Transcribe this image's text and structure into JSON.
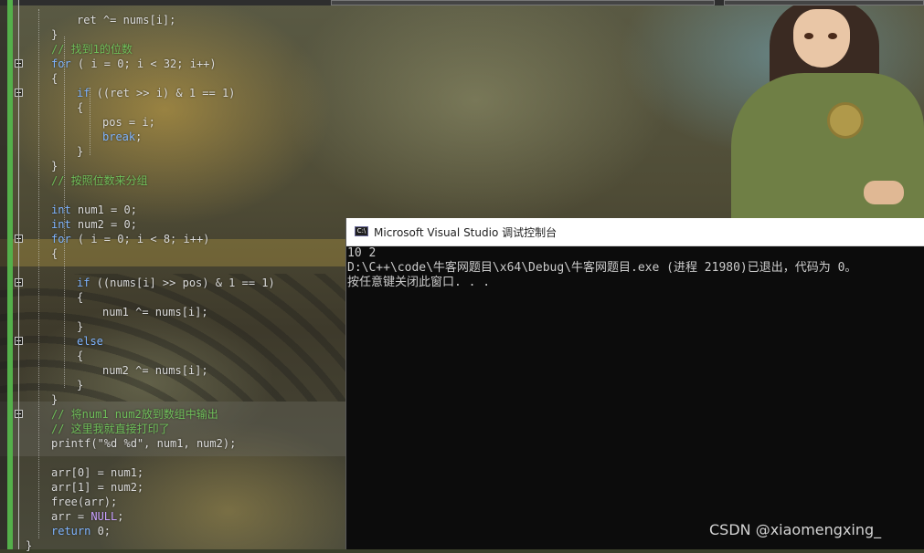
{
  "editor": {
    "code_lines": [
      {
        "indent": 2,
        "text": "ret ^= nums[i];",
        "kind": "code"
      },
      {
        "indent": 1,
        "text": "}",
        "kind": "code"
      },
      {
        "indent": 1,
        "text": "// 找到1的位数",
        "kind": "comment"
      },
      {
        "indent": 1,
        "text": "for ( i = 0; i < 32; i++)",
        "kind": "code"
      },
      {
        "indent": 1,
        "text": "{",
        "kind": "code"
      },
      {
        "indent": 2,
        "text": "if ((ret >> i) & 1 == 1)",
        "kind": "code"
      },
      {
        "indent": 2,
        "text": "{",
        "kind": "code"
      },
      {
        "indent": 3,
        "text": "pos = i;",
        "kind": "code"
      },
      {
        "indent": 3,
        "text": "break;",
        "kind": "code"
      },
      {
        "indent": 2,
        "text": "}",
        "kind": "code"
      },
      {
        "indent": 1,
        "text": "}",
        "kind": "code"
      },
      {
        "indent": 1,
        "text": "// 按照位数来分组",
        "kind": "comment"
      },
      {
        "indent": 0,
        "text": "",
        "kind": "code"
      },
      {
        "indent": 1,
        "text": "int num1 = 0;",
        "kind": "code"
      },
      {
        "indent": 1,
        "text": "int num2 = 0;",
        "kind": "code"
      },
      {
        "indent": 1,
        "text": "for ( i = 0; i < 8; i++)",
        "kind": "code"
      },
      {
        "indent": 1,
        "text": "{",
        "kind": "code"
      },
      {
        "indent": 0,
        "text": "",
        "kind": "code"
      },
      {
        "indent": 2,
        "text": "if ((nums[i] >> pos) & 1 == 1)",
        "kind": "code"
      },
      {
        "indent": 2,
        "text": "{",
        "kind": "code"
      },
      {
        "indent": 3,
        "text": "num1 ^= nums[i];",
        "kind": "code"
      },
      {
        "indent": 2,
        "text": "}",
        "kind": "code"
      },
      {
        "indent": 2,
        "text": "else",
        "kind": "code"
      },
      {
        "indent": 2,
        "text": "{",
        "kind": "code"
      },
      {
        "indent": 3,
        "text": "num2 ^= nums[i];",
        "kind": "code"
      },
      {
        "indent": 2,
        "text": "}",
        "kind": "code"
      },
      {
        "indent": 1,
        "text": "}",
        "kind": "code"
      },
      {
        "indent": 1,
        "text": "// 将num1 num2放到数组中输出",
        "kind": "comment"
      },
      {
        "indent": 1,
        "text": "// 这里我就直接打印了",
        "kind": "comment"
      },
      {
        "indent": 1,
        "text": "printf(\"%d %d\", num1, num2);",
        "kind": "code"
      },
      {
        "indent": 0,
        "text": "",
        "kind": "code"
      },
      {
        "indent": 1,
        "text": "arr[0] = num1;",
        "kind": "code"
      },
      {
        "indent": 1,
        "text": "arr[1] = num2;",
        "kind": "code"
      },
      {
        "indent": 1,
        "text": "free(arr);",
        "kind": "code"
      },
      {
        "indent": 1,
        "text": "arr = NULL;",
        "kind": "code"
      },
      {
        "indent": 1,
        "text": "return 0;",
        "kind": "code"
      },
      {
        "indent": 0,
        "text": "}",
        "kind": "code"
      }
    ],
    "colors": {
      "keyword": "#7fb4ff",
      "comment": "#6fbf5a",
      "gutter_change": "#54b04a"
    }
  },
  "console": {
    "icon_label": "C:\\",
    "title": "Microsoft Visual Studio 调试控制台",
    "output_lines": [
      "10 2",
      "D:\\C++\\code\\牛客网题目\\x64\\Debug\\牛客网题目.exe (进程 21980)已退出，代码为 0。",
      "按任意键关闭此窗口. . ."
    ]
  },
  "watermark": "CSDN @xiaomengxing_"
}
